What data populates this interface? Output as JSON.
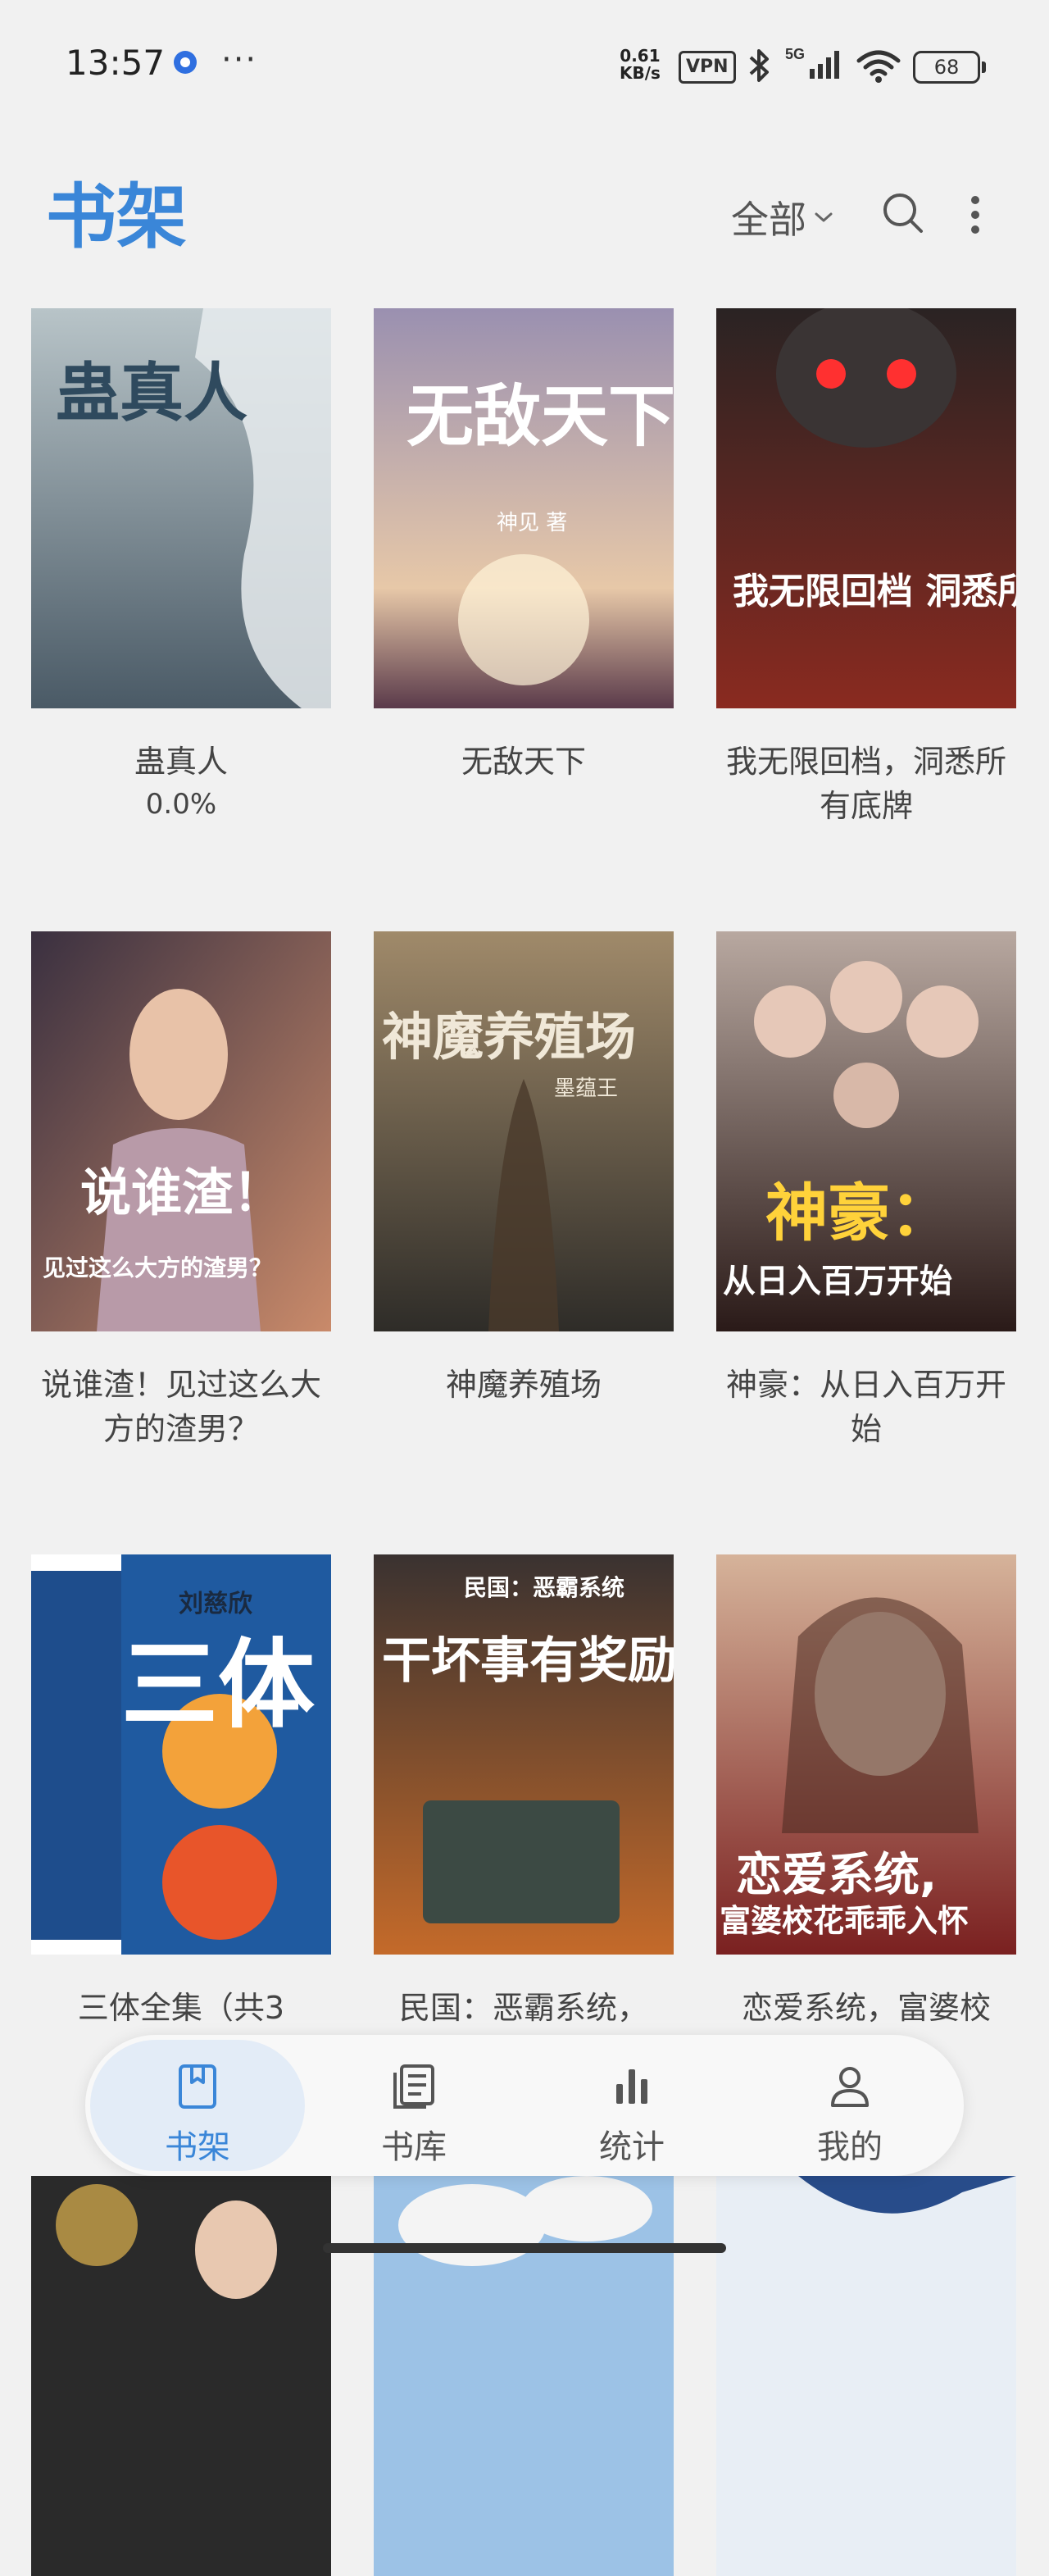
{
  "status_bar": {
    "time": "13:57",
    "dots": "···",
    "net_speed_value": "0.61",
    "net_speed_unit": "KB/s",
    "vpn": "VPN",
    "network": "5G",
    "battery": "68"
  },
  "header": {
    "title": "书架",
    "filter_label": "全部",
    "icons": [
      "chevron-down-icon",
      "search-icon",
      "more-vertical-icon"
    ]
  },
  "books": [
    {
      "title": "蛊真人",
      "progress": "0.0%",
      "cover_text": "蛊真人",
      "cover_sub": "",
      "colors": [
        "#8ea1ab",
        "#4a5a66"
      ]
    },
    {
      "title": "无敌天下",
      "progress": "",
      "cover_text": "无敌天下",
      "cover_sub": "神见 著",
      "colors": [
        "#8d84a3",
        "#e7c8a8"
      ]
    },
    {
      "title": "我无限回档，洞悉所有底牌",
      "progress": "",
      "cover_text": "我无限回档 洞悉所有底牌",
      "cover_sub": "",
      "colors": [
        "#2a2323",
        "#8a2a20"
      ]
    },
    {
      "title": "说谁渣！见过这么大方的渣男？",
      "progress": "",
      "cover_text": "说谁渣！",
      "cover_sub": "见过这么大方的渣男？",
      "colors": [
        "#5b4a4a",
        "#c98a6a"
      ]
    },
    {
      "title": "神魔养殖场",
      "progress": "",
      "cover_text": "神魔养殖场",
      "cover_sub": "墨蕴王",
      "colors": [
        "#7a6850",
        "#3b3a36"
      ]
    },
    {
      "title": "神豪：从日入百万开始",
      "progress": "",
      "cover_text": "神豪：",
      "cover_sub": "从日入百万开始",
      "colors": [
        "#a89890",
        "#2a1a18"
      ]
    },
    {
      "title": "三体全集（共3",
      "progress": "",
      "cover_text": "三体",
      "cover_sub": "刘慈欣",
      "colors": [
        "#1e4d8c",
        "#f3a23a"
      ]
    },
    {
      "title": "民国：恶霸系统，",
      "progress": "",
      "cover_text": "干坏事有奖励!",
      "cover_sub": "民国：恶霸系统",
      "colors": [
        "#3a3230",
        "#c46a2a"
      ]
    },
    {
      "title": "恋爱系统，富婆校",
      "progress": "",
      "cover_text": "恋爱系统,",
      "cover_sub": "富婆校花乖乖入怀",
      "colors": [
        "#d6b39a",
        "#7a2020"
      ]
    },
    {
      "title": "",
      "progress": "",
      "cover_text": "",
      "cover_sub": "",
      "colors": [
        "#2a2a2a",
        "#c9a24a"
      ]
    },
    {
      "title": "",
      "progress": "",
      "cover_text": "",
      "cover_sub": "",
      "colors": [
        "#9cc2e6",
        "#f4f4f4"
      ]
    },
    {
      "title": "",
      "progress": "",
      "cover_text": "",
      "cover_sub": "",
      "colors": [
        "#e8eef5",
        "#284c8a"
      ]
    }
  ],
  "bottom_nav": {
    "items": [
      {
        "label": "书架",
        "icon": "bookshelf-icon",
        "active": true
      },
      {
        "label": "书库",
        "icon": "library-icon",
        "active": false
      },
      {
        "label": "统计",
        "icon": "stats-icon",
        "active": false
      },
      {
        "label": "我的",
        "icon": "profile-icon",
        "active": false
      }
    ]
  },
  "colors": {
    "accent": "#3a86d8",
    "background": "#f1f1f1",
    "nav_active_bg": "#e3ecf7"
  }
}
